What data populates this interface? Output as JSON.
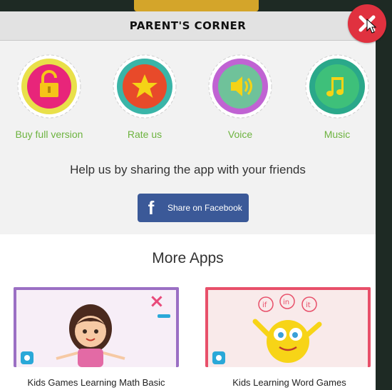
{
  "dialog": {
    "title": "PARENT'S CORNER"
  },
  "icons": [
    {
      "label": "Buy full version",
      "icon": "unlock-icon",
      "ring": "#e9e04a",
      "fill": "#e8257a"
    },
    {
      "label": "Rate us",
      "icon": "star-icon",
      "ring": "#3ab5a8",
      "fill": "#e84a2a"
    },
    {
      "label": "Voice",
      "icon": "speaker-icon",
      "ring": "#c063d3",
      "fill": "#6fc29a"
    },
    {
      "label": "Music",
      "icon": "music-note-icon",
      "ring": "#2aa88a",
      "fill": "#3ec07a"
    }
  ],
  "share": {
    "text": "Help us by sharing the app with your friends",
    "button_label": "Share on Facebook"
  },
  "more_apps": {
    "title": "More Apps",
    "apps": [
      {
        "name": "Kids Games Learning Math Basic"
      },
      {
        "name": "Kids Learning Word Games"
      }
    ]
  },
  "colors": {
    "facebook": "#3b5998",
    "close": "#e0313f",
    "label_green": "#6db33f"
  }
}
